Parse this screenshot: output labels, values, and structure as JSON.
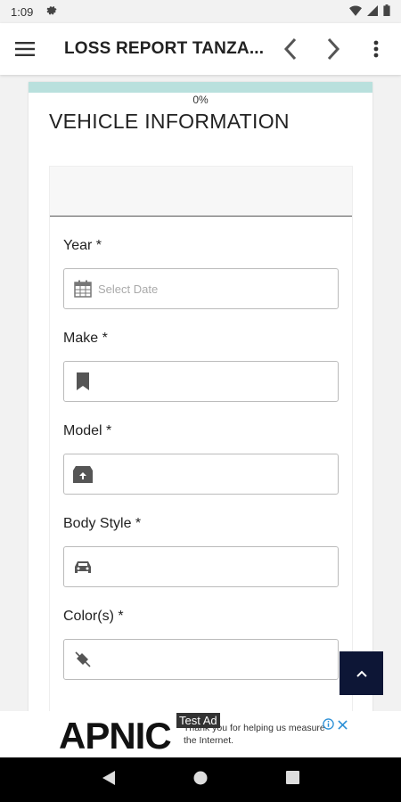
{
  "status_bar": {
    "time": "1:09"
  },
  "app_bar": {
    "title": "LOSS REPORT TANZA..."
  },
  "form": {
    "progress_percent": 0,
    "progress_label": "0%",
    "section_title": "VEHICLE INFORMATION",
    "fields": [
      {
        "label": "Year *",
        "placeholder": "Select Date",
        "value": "",
        "icon": "calendar-icon"
      },
      {
        "label": "Make *",
        "placeholder": "",
        "value": "",
        "icon": "bookmark-icon"
      },
      {
        "label": "Model *",
        "placeholder": "",
        "value": "",
        "icon": "archive-box-icon"
      },
      {
        "label": "Body Style *",
        "placeholder": "",
        "value": "",
        "icon": "car-icon"
      },
      {
        "label": "Color(s) *",
        "placeholder": "",
        "value": "",
        "icon": "color-fill-icon"
      }
    ]
  },
  "ad": {
    "logo_text": "APNIC",
    "tag": "Test Ad",
    "text": "Thank you for helping us measure the Internet."
  },
  "colors": {
    "progress_track": "#b9e0dd",
    "fab_background": "#0d1636",
    "nav_bar": "#000000"
  }
}
